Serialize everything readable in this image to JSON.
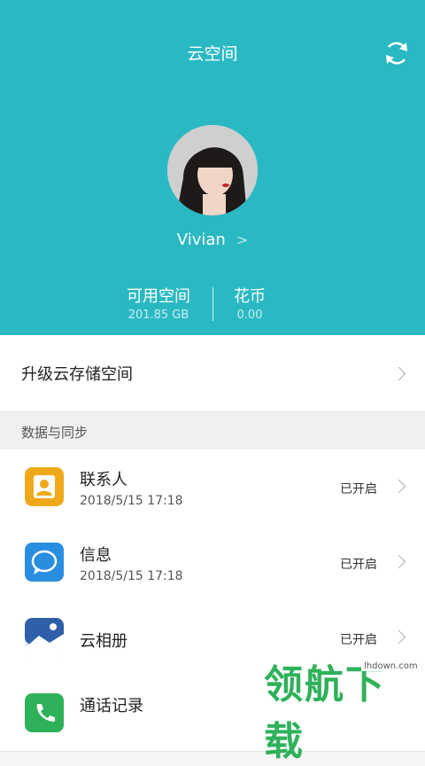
{
  "header": {
    "title": "云空间",
    "username": "Vivian",
    "stats": [
      {
        "label": "可用空间",
        "value": "201.85 GB"
      },
      {
        "label": "花币",
        "value": "0.00"
      }
    ]
  },
  "upgrade": {
    "label": "升级云存储空间"
  },
  "section": {
    "title": "数据与同步"
  },
  "rows": [
    {
      "name": "联系人",
      "time": "2018/5/15 17:18",
      "status": "已开启",
      "icon": "contacts-icon"
    },
    {
      "name": "信息",
      "time": "2018/5/15 17:18",
      "status": "已开启",
      "icon": "messages-icon"
    },
    {
      "name": "云相册",
      "status": "已开启",
      "icon": "gallery-icon"
    },
    {
      "name": "通话记录",
      "icon": "call-log-icon"
    }
  ],
  "watermark": {
    "main": "领航下载",
    "site": "lhdown.com"
  },
  "colors": {
    "accent": "#2ab9c3",
    "contacts": "#f0a81b",
    "messages": "#2a8ee0"
  }
}
